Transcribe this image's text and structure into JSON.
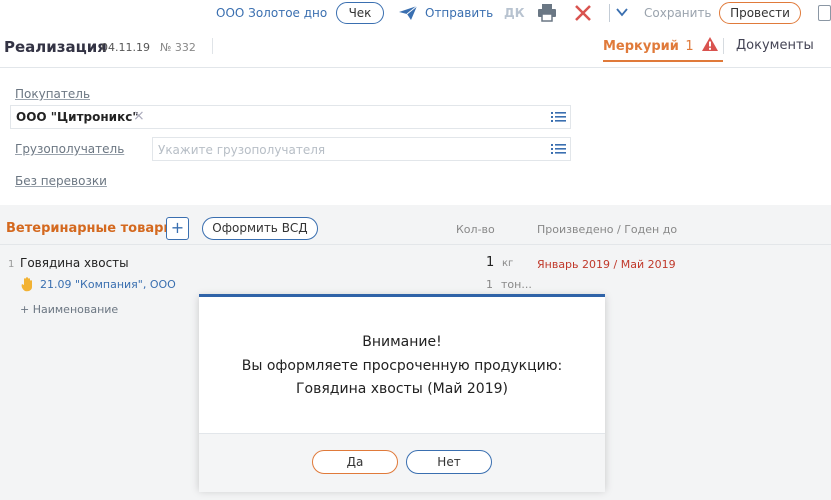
{
  "toolbar": {
    "org": "ООО Золотое дно",
    "check_label": "Чек",
    "send_label": "Отправить",
    "dk_label": "ДК",
    "save_label": "Сохранить",
    "post_label": "Провести",
    "icons": [
      "send-icon",
      "print-icon",
      "close-icon",
      "chevron-down-icon",
      "copy-icon"
    ]
  },
  "document": {
    "title": "Реализация",
    "date": "04.11.19",
    "number": "№ 332",
    "tabs": [
      {
        "label": "Меркурий",
        "count": "1",
        "active": true
      },
      {
        "label": "Документы",
        "active": false
      }
    ]
  },
  "form": {
    "buyer_label": "Покупатель",
    "buyer_value": "ООО \"Цитроникс\"",
    "buyer_clear": "×",
    "consignee_label": "Грузополучатель",
    "consignee_placeholder": "Укажите грузополучателя",
    "transport_label": "Без перевозки"
  },
  "goods": {
    "title": "Ветеринарные товары",
    "add_symbol": "+",
    "vsd_button": "Оформить ВСД",
    "col_qty": "Кол-во",
    "col_dates": "Произведено / Годен до",
    "rows": [
      {
        "num": "1",
        "name": "Говядина хвосты",
        "qty": "1",
        "unit": "кг",
        "dates": "Январь 2019 / Май 2019",
        "sub": {
          "company": "21.09 \"Компания\", ООО",
          "qty": "1",
          "unit": "тон..."
        }
      }
    ],
    "add_item": "+ Наименование"
  },
  "modal": {
    "line1": "Внимание!",
    "line2": "Вы оформляете просроченную продукцию:",
    "line3": "Говядина хвосты (Май 2019)",
    "yes": "Да",
    "no": "Нет"
  },
  "colors": {
    "accent_orange": "#e07a3a",
    "accent_blue": "#3a6fb0",
    "warning_red": "#c0392b",
    "modal_top": "#2f63a8"
  }
}
